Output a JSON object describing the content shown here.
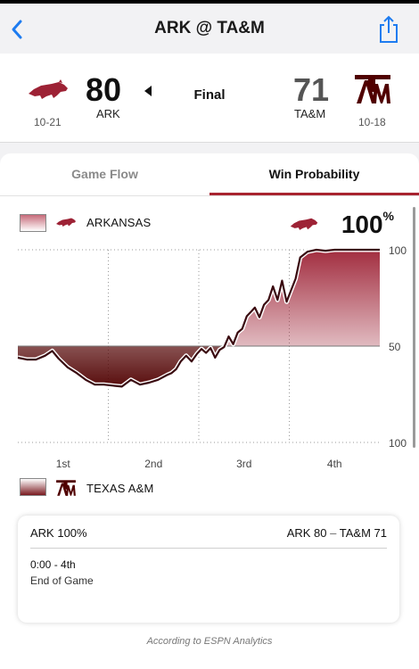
{
  "nav": {
    "title": "ARK @ TA&M"
  },
  "scoreboard": {
    "away": {
      "score": "80",
      "abbr": "ARK",
      "record": "10-21"
    },
    "home": {
      "score": "71",
      "abbr": "TA&M",
      "record": "10-18"
    },
    "status": "Final"
  },
  "tabs": {
    "game_flow": "Game Flow",
    "win_probability": "Win Probability",
    "selected": "Win Probability"
  },
  "win_prob": {
    "top_team": "ARKANSAS",
    "bottom_team": "TEXAS A&M",
    "current_pct": "100",
    "pct_sign": "%"
  },
  "detail": {
    "left": "ARK 100%",
    "right_away": "ARK 80",
    "right_sep": "–",
    "right_home": "TA&M 71",
    "time": "0:00 - 4th",
    "description": "End of Game",
    "attribution": "According to ESPN Analytics"
  },
  "colors": {
    "arkansas": "#9d2235",
    "texas_am": "#500000",
    "accent": "#a8232f",
    "ios_blue": "#1e7cf0"
  },
  "icons": {
    "back": "chevron-left-icon",
    "share": "share-icon",
    "ark_logo": "razorback-logo",
    "tamu_logo": "atm-logo"
  },
  "chart_data": {
    "type": "area",
    "title": "",
    "xlabel": "",
    "ylabel": "",
    "x_tick_labels": [
      "1st",
      "2nd",
      "3rd",
      "4th"
    ],
    "y_tick_labels_top": [
      "100",
      "50"
    ],
    "y_tick_labels_bottom": [
      "100"
    ],
    "xlim": [
      0,
      40
    ],
    "ylim": [
      -100,
      100
    ],
    "series": [
      {
        "x": [
          0,
          1,
          2,
          3,
          3.8,
          4.5,
          5.5,
          6.5,
          7.5,
          8.5,
          9.5,
          10.5,
          11.5,
          12.5,
          13.5,
          14.5,
          15.5,
          16.5,
          17,
          17.5,
          18,
          18.6,
          19.2,
          19.8,
          20.3,
          20.8,
          21.3,
          21.8,
          22.3,
          22.8,
          23.3,
          23.8,
          24.3,
          24.8,
          25.3,
          25.8,
          26.2,
          26.7,
          27.2,
          27.7,
          28.2,
          28.7,
          29.2,
          29.7,
          30.2,
          30.7,
          31.2,
          32,
          33,
          34,
          35,
          36,
          37,
          38,
          39,
          40
        ],
        "y": [
          -12,
          -14,
          -14,
          -10,
          -5,
          -13,
          -22,
          -28,
          -35,
          -40,
          -40,
          -41,
          -42,
          -35,
          -40,
          -38,
          -35,
          -30,
          -28,
          -24,
          -16,
          -10,
          -16,
          -8,
          -3,
          -7,
          -2,
          -12,
          -4,
          -1,
          10,
          2,
          14,
          18,
          31,
          36,
          40,
          30,
          43,
          48,
          62,
          48,
          68,
          46,
          58,
          70,
          92,
          98,
          100,
          99,
          100,
          100,
          100,
          100,
          100,
          100
        ]
      }
    ]
  }
}
